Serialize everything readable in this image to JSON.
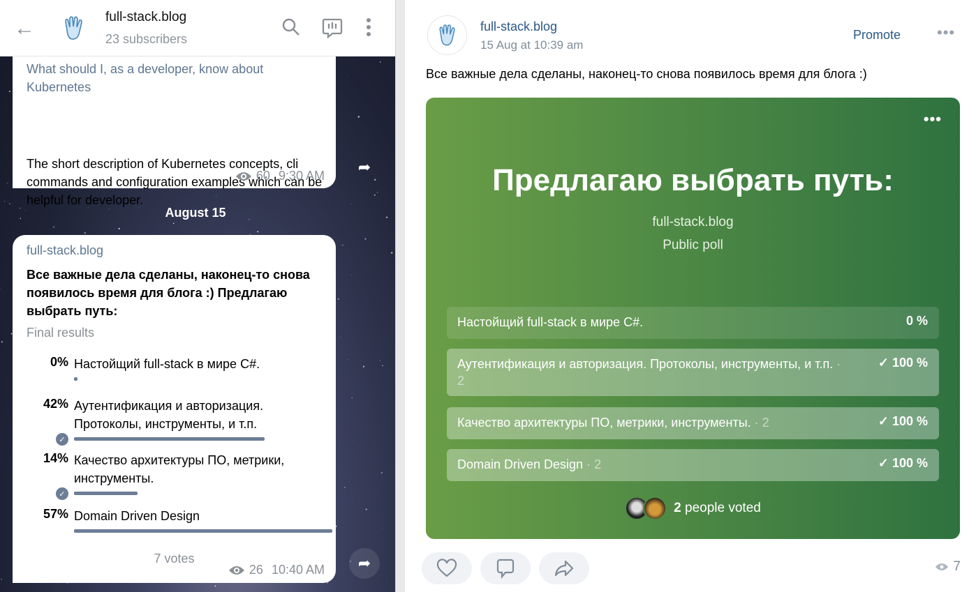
{
  "telegram": {
    "header": {
      "title": "full-stack.blog",
      "subscribers": "23 subscribers"
    },
    "message1": {
      "link_title": "What should I, as a developer, know about Kubernetes",
      "description": "The short description of Kubernetes concepts, cli commands and configuration examples which can be helpful for developer.",
      "views": "60",
      "time": "9:30 AM"
    },
    "date_separator": "August 15",
    "message2": {
      "channel": "full-stack.blog",
      "question": "Все важные дела сделаны, наконец-то снова появилось время для блога :) Предлагаю выбрать путь:",
      "status": "Final results",
      "options": [
        {
          "percent": "0%",
          "value": 0,
          "label": "Настойщий full-stack в мире C#.",
          "chosen": false
        },
        {
          "percent": "42%",
          "value": 42,
          "label": "Аутентификация и авторизация. Протоколы, инструменты, и т.п.",
          "chosen": true
        },
        {
          "percent": "14%",
          "value": 14,
          "label": "Качество архитектуры ПО, метрики, инструменты.",
          "chosen": true
        },
        {
          "percent": "57%",
          "value": 57,
          "label": "Domain Driven Design",
          "chosen": false
        }
      ],
      "votes": "7 votes",
      "views": "26",
      "time": "10:40 AM"
    }
  },
  "vk": {
    "author": "full-stack.blog",
    "date": "15 Aug at 10:39 am",
    "promote": "Promote",
    "text": "Все важные дела сделаны, наконец-то снова появилось время для блога :)",
    "poll": {
      "title": "Предлагаю выбрать путь:",
      "author": "full-stack.blog",
      "type": "Public poll",
      "options": [
        {
          "label": "Настойщий full-stack в мире C#.",
          "count": "",
          "percent": "0 %",
          "value": 0,
          "chosen": false
        },
        {
          "label": "Аутентификация и авторизация. Протоколы, инструменты, и т.п.",
          "count": "· 2",
          "percent": "100 %",
          "value": 100,
          "chosen": true
        },
        {
          "label": "Качество архитектуры ПО, метрики, инструменты.",
          "count": "· 2",
          "percent": "100 %",
          "value": 100,
          "chosen": true
        },
        {
          "label": "Domain Driven Design",
          "count": "· 2",
          "percent": "100 %",
          "value": 100,
          "chosen": true
        }
      ],
      "voted_count": "2",
      "voted_label": "people voted",
      "colors": {
        "start": "#6a9d46",
        "end": "#2f7240"
      }
    },
    "views": "7"
  }
}
